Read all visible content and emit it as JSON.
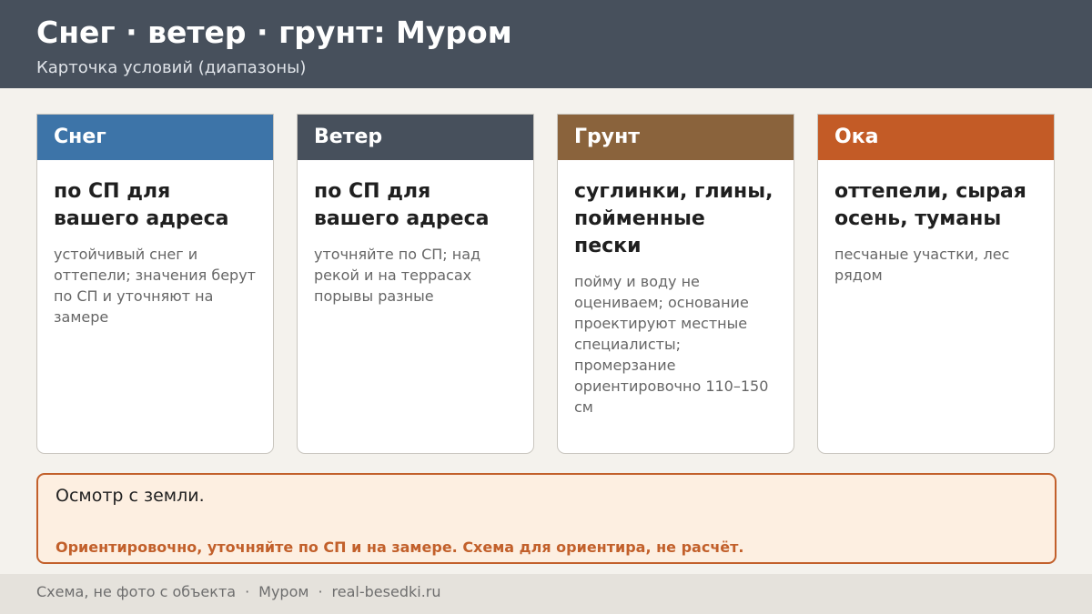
{
  "header": {
    "title": "Снег · ветер · грунт: Муром",
    "subtitle": "Карточка условий (диапазоны)"
  },
  "cards": [
    {
      "label": "Снег",
      "color": "#3d74a8",
      "main": "по СП для вашего адреса",
      "note": "устойчивый снег и оттепели; значения берут по СП и уточняют на замере"
    },
    {
      "label": "Ветер",
      "color": "#47505c",
      "main": "по СП для вашего адреса",
      "note": "уточняйте по СП; над рекой и на террасах порывы разные"
    },
    {
      "label": "Грунт",
      "color": "#8a633c",
      "main": "суглинки, глины, пойменные пески",
      "note": "пойму и воду не оцениваем; основание проектируют местные специалисты; промерзание ориентировочно 110–150 см"
    },
    {
      "label": "Ока",
      "color": "#c35b26",
      "main": "оттепели, сырая осень, туманы",
      "note": "песчаные участки, лес рядом"
    }
  ],
  "note": {
    "main": "Осмотр с земли.",
    "warning": "Ориентировочно, уточняйте по СП и на замере. Схема для ориентира, не расчёт."
  },
  "footer": {
    "left": "Схема, не фото с объекта",
    "middle": "Муром",
    "right": "real-besedki.ru",
    "separator": "·"
  }
}
